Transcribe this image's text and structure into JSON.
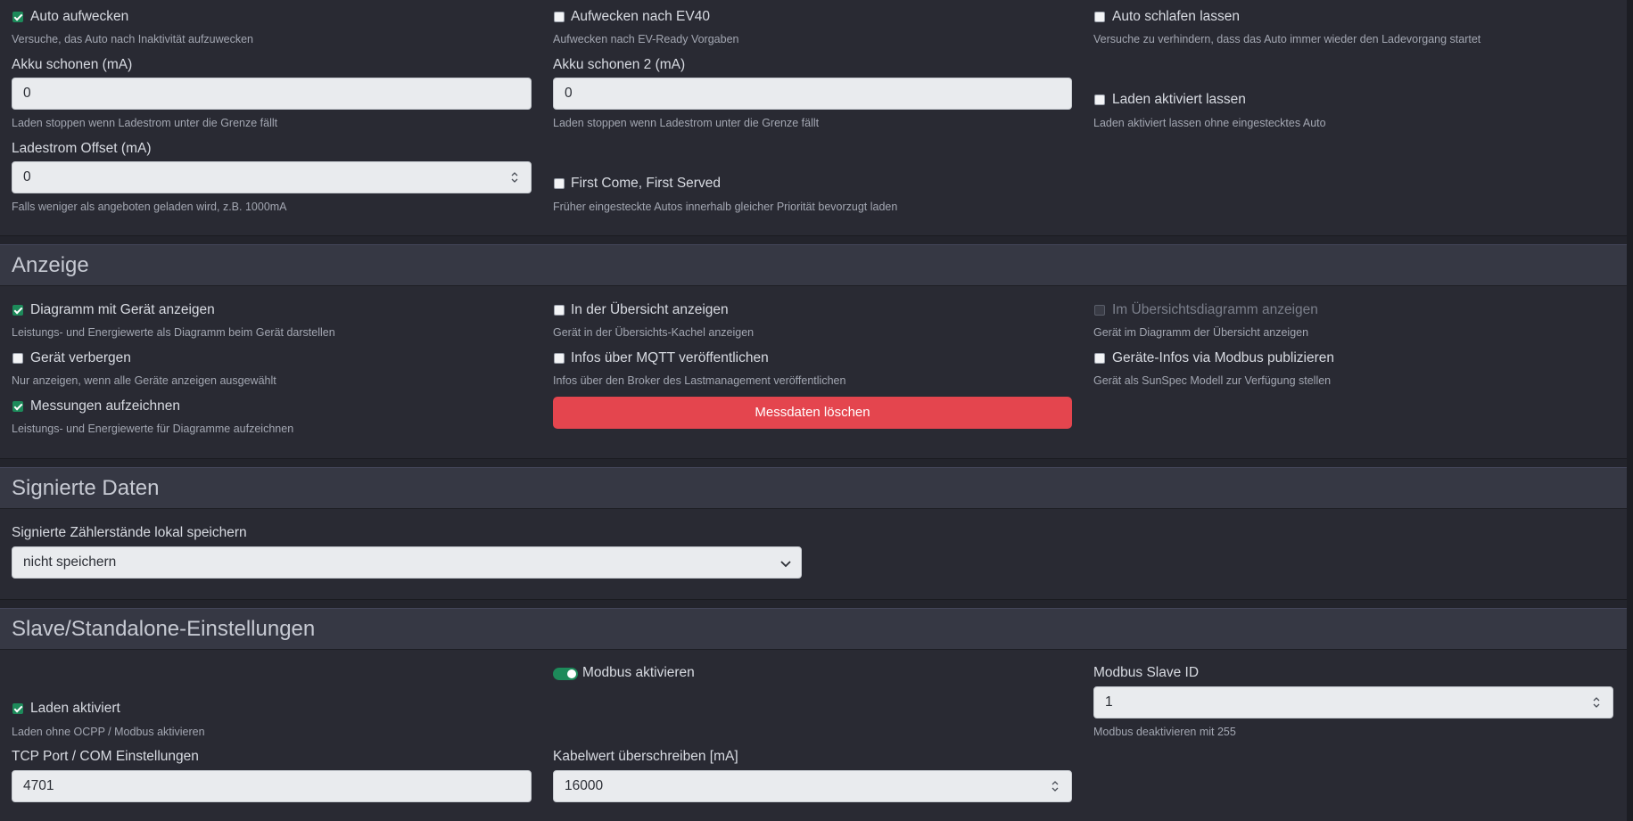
{
  "charging": {
    "auto_wake": {
      "label": "Auto aufwecken",
      "help": "Versuche, das Auto nach Inaktivität aufzuwecken",
      "checked": true
    },
    "wake_ev40": {
      "label": "Aufwecken nach EV40",
      "help": "Aufwecken nach EV-Ready Vorgaben",
      "checked": false
    },
    "auto_sleep": {
      "label": "Auto schlafen lassen",
      "help": "Versuche zu verhindern, dass das Auto immer wieder den Ladevorgang startet",
      "checked": false
    },
    "battery_protect": {
      "label": "Akku schonen (mA)",
      "value": "0",
      "help": "Laden stoppen wenn Ladestrom unter die Grenze fällt"
    },
    "battery_protect2": {
      "label": "Akku schonen 2 (mA)",
      "value": "0",
      "help": "Laden stoppen wenn Ladestrom unter die Grenze fällt"
    },
    "keep_enabled": {
      "label": "Laden aktiviert lassen",
      "help": "Laden aktiviert lassen ohne eingestecktes Auto",
      "checked": false
    },
    "current_offset": {
      "label": "Ladestrom Offset (mA)",
      "value": "0",
      "help": "Falls weniger als angeboten geladen wird, z.B. 1000mA"
    },
    "fcfs": {
      "label": "First Come, First Served",
      "help": "Früher eingesteckte Autos innerhalb gleicher Priorität bevorzugt laden",
      "checked": false
    }
  },
  "display": {
    "title": "Anzeige",
    "show_chart": {
      "label": "Diagramm mit Gerät anzeigen",
      "help": "Leistungs- und Energiewerte als Diagramm beim Gerät darstellen",
      "checked": true
    },
    "show_overview": {
      "label": "In der Übersicht anzeigen",
      "help": "Gerät in der Übersichts-Kachel anzeigen",
      "checked": false
    },
    "show_overview_chart": {
      "label": "Im Übersichtsdiagramm anzeigen",
      "help": "Gerät im Diagramm der Übersicht anzeigen",
      "checked": false
    },
    "hide_device": {
      "label": "Gerät verbergen",
      "help": "Nur anzeigen, wenn alle Geräte anzeigen ausgewählt",
      "checked": false
    },
    "mqtt_publish": {
      "label": "Infos über MQTT veröffentlichen",
      "help": "Infos über den Broker des Lastmanagement veröffentlichen",
      "checked": false
    },
    "modbus_publish": {
      "label": "Geräte-Infos via Modbus publizieren",
      "help": "Gerät als SunSpec Modell zur Verfügung stellen",
      "checked": false
    },
    "record": {
      "label": "Messungen aufzeichnen",
      "help": "Leistungs- und Energiewerte für Diagramme aufzeichnen",
      "checked": true
    },
    "delete_button": "Messdaten löschen"
  },
  "signed": {
    "title": "Signierte Daten",
    "store_label": "Signierte Zählerstände lokal speichern",
    "store_value": "nicht speichern"
  },
  "slave": {
    "title": "Slave/Standalone-Einstellungen",
    "modbus_enable": {
      "label": "Modbus aktivieren",
      "on": true
    },
    "slave_id": {
      "label": "Modbus Slave ID",
      "value": "1",
      "help": "Modbus deaktivieren mit 255"
    },
    "charge_enabled": {
      "label": "Laden aktiviert",
      "help": "Laden ohne OCPP / Modbus aktivieren",
      "checked": true
    },
    "tcp_port": {
      "label": "TCP Port / COM Einstellungen",
      "value": "4701"
    },
    "cable_override": {
      "label": "Kabelwert überschreiben [mA]",
      "value": "16000"
    }
  },
  "colors": {
    "accent": "#1d8a5a",
    "danger": "#e4454e",
    "background": "#23242c",
    "panel_header": "#363844"
  }
}
